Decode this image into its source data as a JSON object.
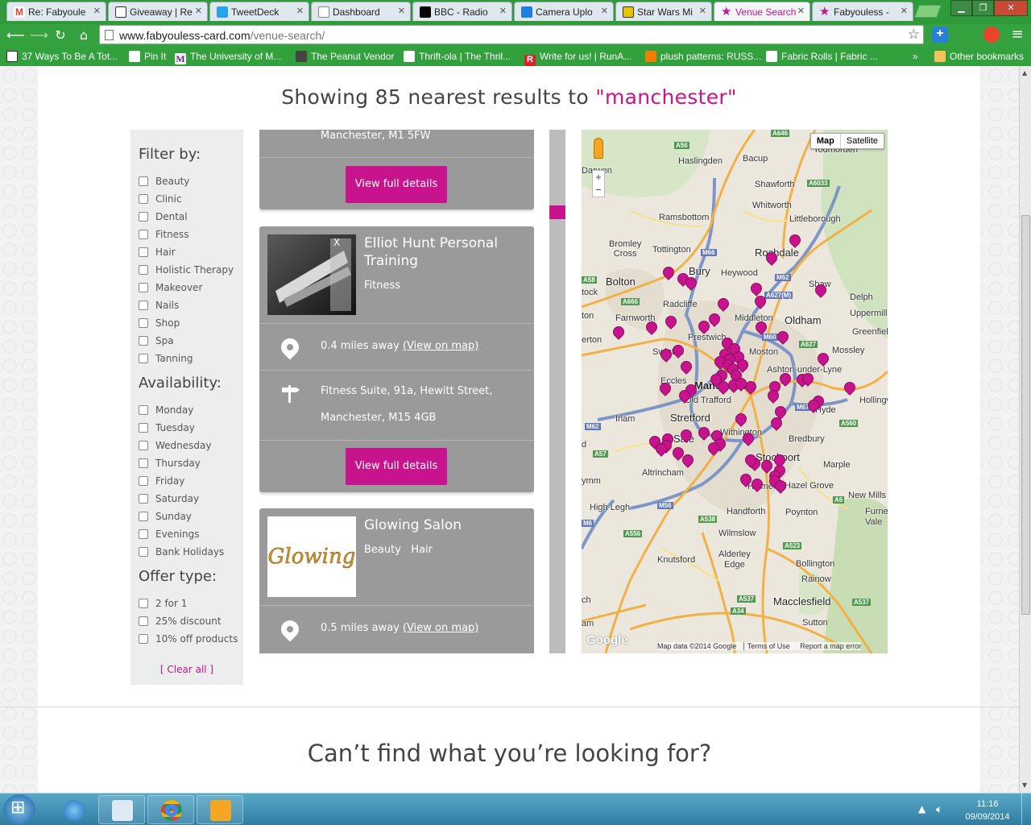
{
  "browser": {
    "tabs": [
      {
        "label": "Re: Fabyoule",
        "color": "#d14836"
      },
      {
        "label": "Giveaway | Re",
        "color": "#333333"
      },
      {
        "label": "TweetDeck",
        "color": "#2aa3ef"
      },
      {
        "label": "Dashboard",
        "color": "#ffffff"
      },
      {
        "label": "BBC - Radio",
        "color": "#000000"
      },
      {
        "label": "Camera Uplo",
        "color": "#1e7fe0"
      },
      {
        "label": "Star Wars Mi",
        "color": "#e8c400"
      },
      {
        "label": "Venue Search",
        "color": "#c7138c"
      },
      {
        "label": "Fabyouless -",
        "color": "#c7138c"
      }
    ],
    "url_domain": "www.fabyouless-card.com",
    "url_path": "/venue-search/",
    "bookmarks": [
      "37 Ways To Be A Tot...",
      "Pin It",
      "The University of M...",
      "The Peanut Vendor",
      "Thrift-ola | The Thril...",
      "Write for us! | RunA...",
      "plush patterns: RUSS...",
      "Fabric Rolls | Fabric ...",
      "Other bookmarks"
    ],
    "bookmarks_overflow": "»"
  },
  "page": {
    "heading_prefix": "Showing 85 nearest results to ",
    "heading_query": "\"manchester\"",
    "filters": {
      "filter_by_title": "Filter by:",
      "categories": [
        "Beauty",
        "Clinic",
        "Dental",
        "Fitness",
        "Hair",
        "Holistic Therapy",
        "Makeover",
        "Nails",
        "Shop",
        "Spa",
        "Tanning"
      ],
      "availability_title": "Availability:",
      "availability": [
        "Monday",
        "Tuesday",
        "Wednesday",
        "Thursday",
        "Friday",
        "Saturday",
        "Sunday",
        "Evenings",
        "Bank Holidays"
      ],
      "offer_title": "Offer type:",
      "offers": [
        "2 for 1",
        "25% discount",
        "10% off products"
      ],
      "clear_all": "[ Clear all ]"
    },
    "results": {
      "partial": {
        "address_tail": "Manchester, M1 5FW",
        "details_button": "View full details"
      },
      "items": [
        {
          "name": "Elliot Hunt Personal Training",
          "categories": "Fitness",
          "distance": "0.4 miles away ",
          "view_on_map": "(View on map)",
          "address_line1": "Fitness Suite, 91a, Hewitt Street,",
          "address_line2": "Manchester, M15 4GB",
          "details_button": "View full details"
        },
        {
          "name": "Glowing Salon",
          "categories": "Beauty   Hair",
          "logo_text": "Glowing",
          "distance": "0.5 miles away ",
          "view_on_map": "(View on map)"
        }
      ]
    },
    "map": {
      "type_map": "Map",
      "type_satellite": "Satellite",
      "zoom_in": "+",
      "zoom_out": "−",
      "attribution": "Map data ©2014 Google",
      "terms": "Terms of Use",
      "report": "Report a map error",
      "google": "Google",
      "places": {
        "bacup": "Bacup",
        "haslingden": "Haslingden",
        "todmorden": "Todmorden",
        "darwen": "Darwen",
        "shawforth": "Shawforth",
        "whitworth": "Whitworth",
        "ramsbottom": "Ramsbottom",
        "littleborough": "Littleborough",
        "bromley_cross": "Bromley\nCross",
        "tottington": "Tottington",
        "rochdale": "Rochdale",
        "bolton": "Bolton",
        "bury": "Bury",
        "heywood": "Heywood",
        "shaw": "Shaw",
        "radcliffe": "Radcliffe",
        "delph": "Delph",
        "uppermill": "Uppermill",
        "farnworth": "Farnworth",
        "middleton": "Middleton",
        "oldham": "Oldham",
        "greenfield": "Greenfield",
        "prestwich": "Prestwich",
        "swinton": "Swinton",
        "moston": "Moston",
        "mossley": "Mossley",
        "eccles": "Eccles",
        "manchester": "Manchester",
        "ashton": "Ashton-under-Lyne",
        "old_trafford": "Old Trafford",
        "hyde": "Hyde",
        "irlam": "Irlam",
        "stretford": "Stretford",
        "hollingworth": "Hollingw",
        "withington": "Withington",
        "sale": "Sale",
        "bredbury": "Bredbury",
        "stockport": "Stockport",
        "altrincham": "Altrincham",
        "cheadle_hulme": "Hulme",
        "hazel_grove": "Hazel Grove",
        "marple": "Marple",
        "new_mills": "New Mills",
        "high_legh": "High Legh",
        "handforth": "Handforth",
        "poynton": "Poynton",
        "furness_vale": "Furne\nVale",
        "wilmslow": "Wilmslow",
        "knutsford": "Knutsford",
        "alderley_edge": "Alderley\nEdge",
        "bollington": "Bollington",
        "rainow": "Rainow",
        "macclesfield": "Macclesfield",
        "sutton": "Sutton",
        "tockholes": "tock",
        "lymm": "ymm",
        "horwich": "ton",
        "erton": "erton",
        "ch": "ch",
        "am": "am",
        "d": "d"
      },
      "roads": [
        "A646",
        "A56",
        "A6033",
        "A58",
        "M66",
        "M62",
        "A627(M)",
        "A666",
        "M60",
        "A627",
        "A57",
        "M62",
        "A560",
        "A6",
        "M56",
        "A556",
        "A538",
        "A523",
        "A537",
        "A537",
        "A34",
        "M6",
        "M67"
      ]
    },
    "bottom_heading": "Can’t find what you’re looking for?"
  },
  "taskbar": {
    "time": "11:16",
    "date": "09/09/2014"
  },
  "colors": {
    "accent": "#c7138c",
    "card_bg": "#9a9a9a",
    "chrome_green": "#36a23f"
  }
}
